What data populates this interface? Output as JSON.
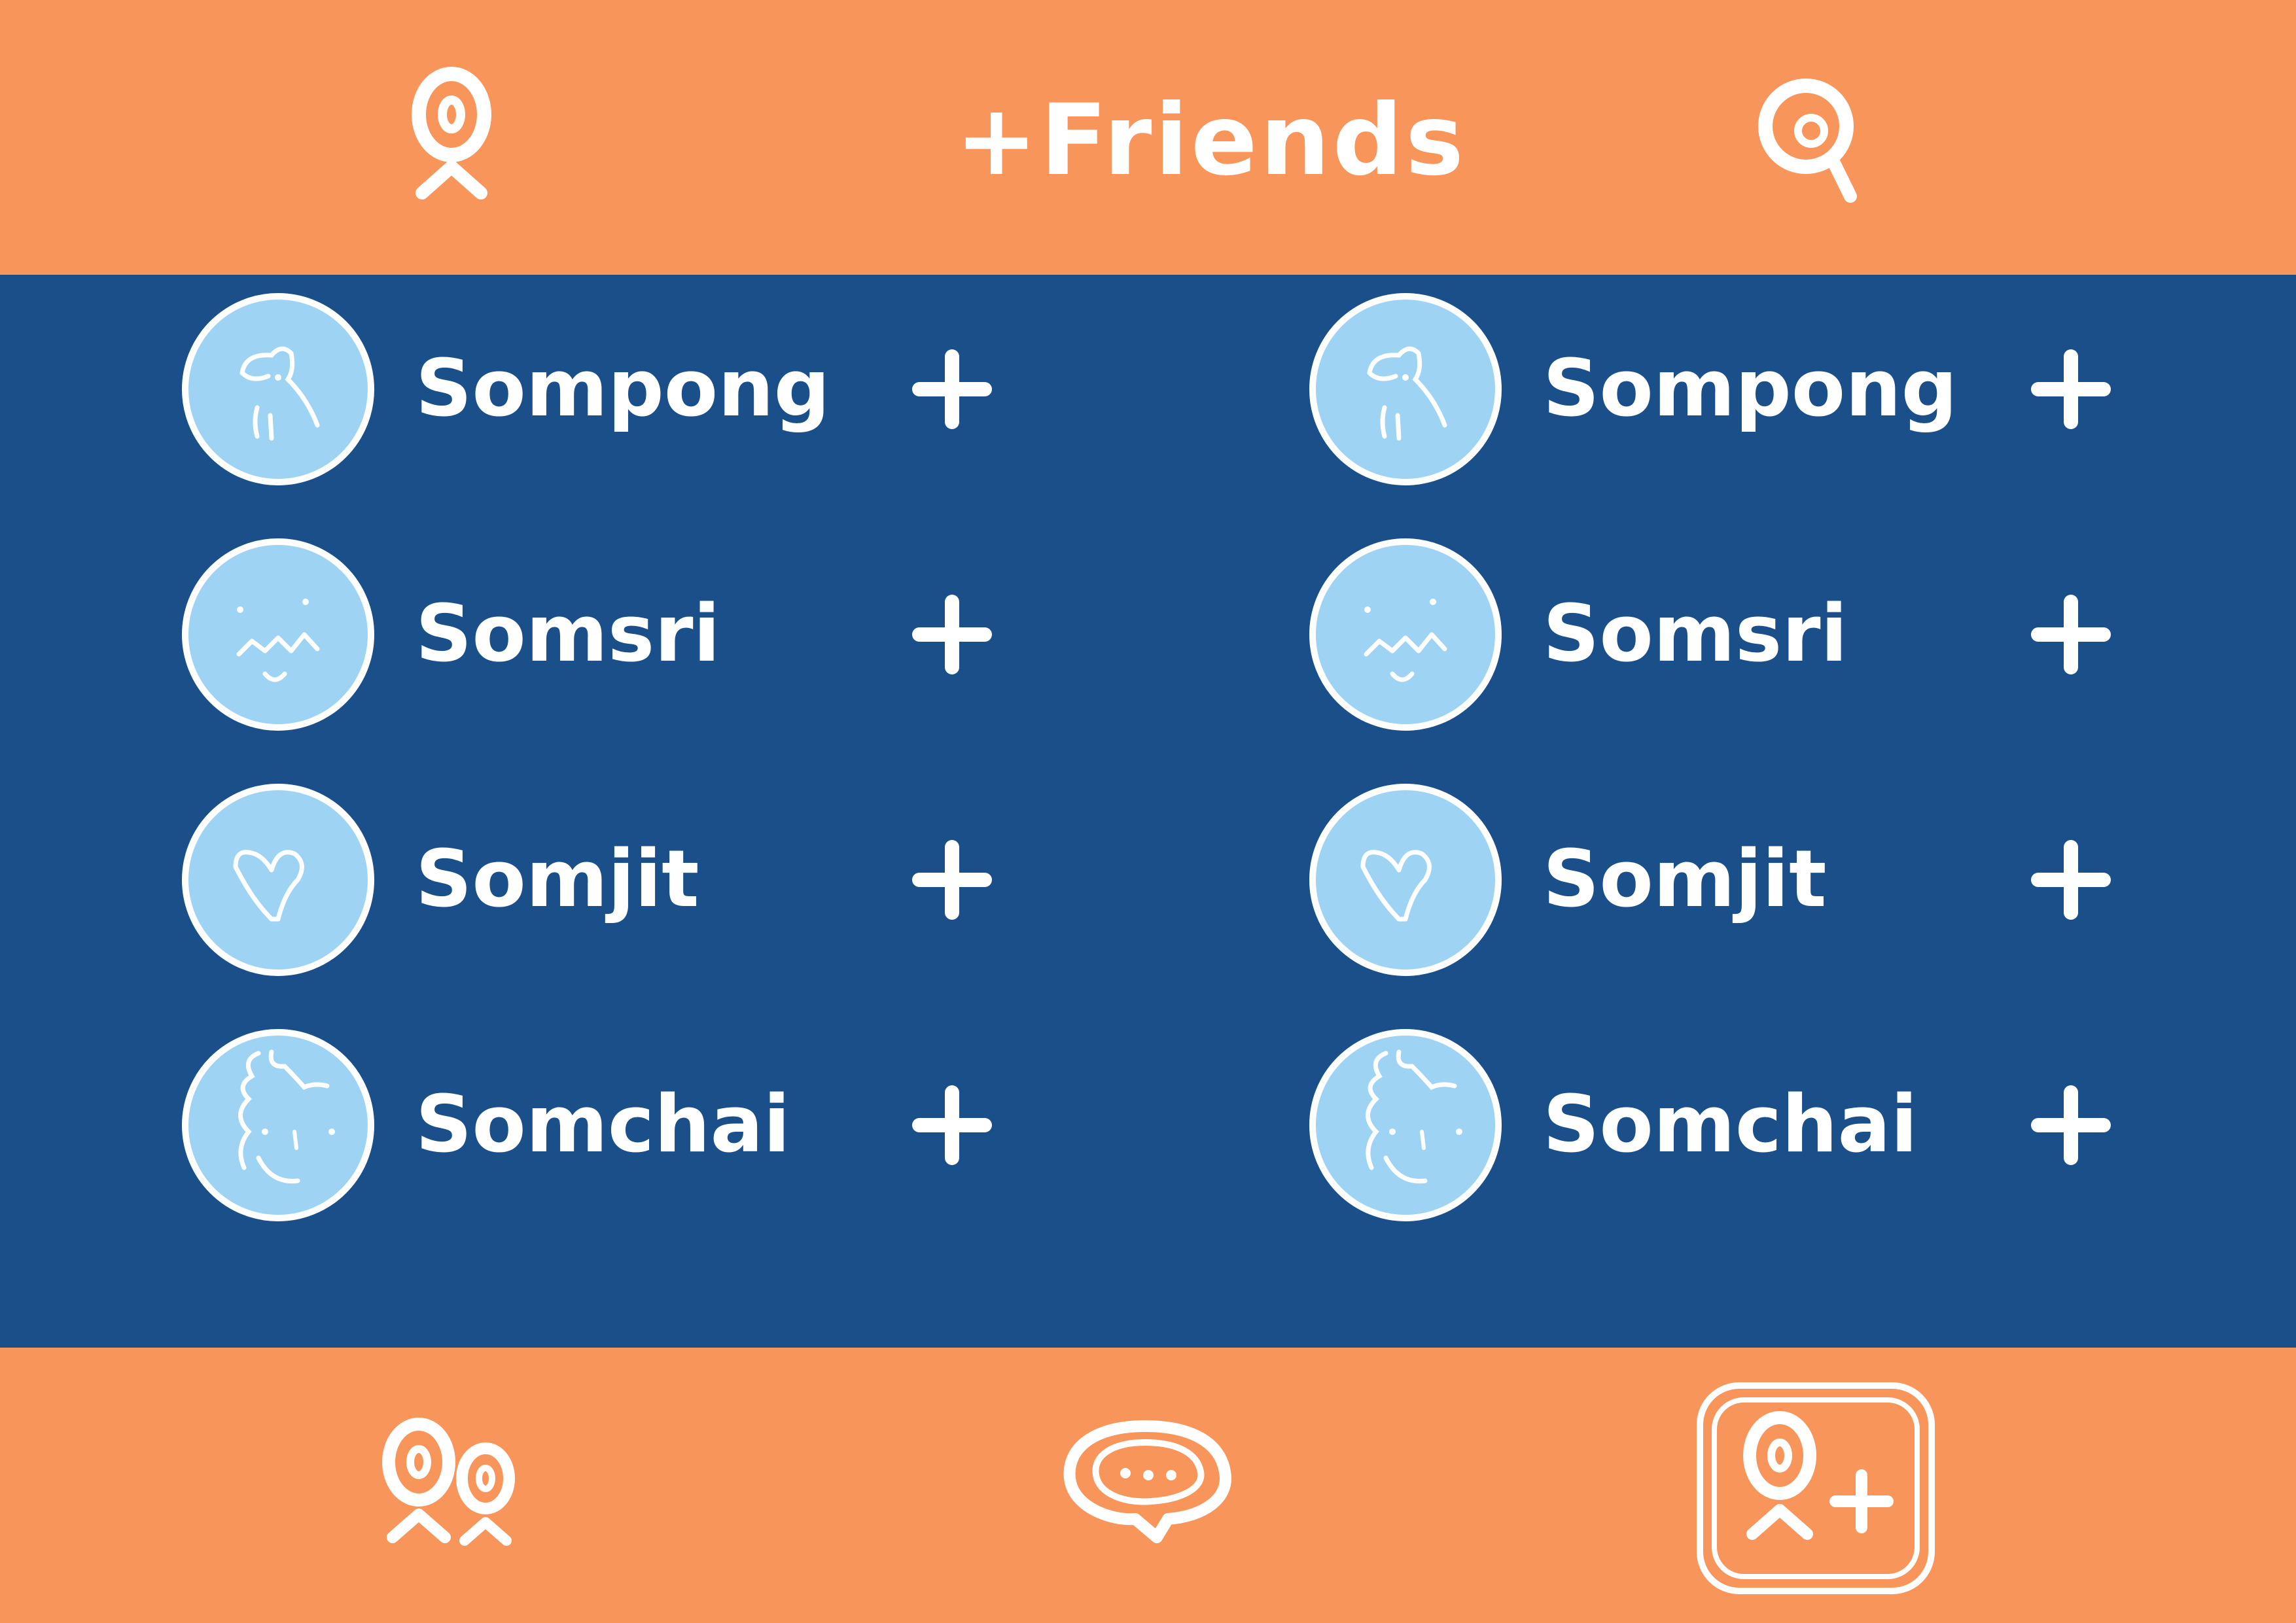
{
  "header": {
    "title": "+Friends",
    "profile_icon": "profile-icon",
    "search_icon": "search-icon"
  },
  "friends": [
    {
      "name": "Sompong",
      "avatar": "elephant-avatar",
      "add": "+"
    },
    {
      "name": "Somsri",
      "avatar": "smile-face-avatar",
      "add": "+"
    },
    {
      "name": "Somjit",
      "avatar": "heart-avatar",
      "add": "+"
    },
    {
      "name": "Somchai",
      "avatar": "curly-hair-face-avatar",
      "add": "+"
    },
    {
      "name": "Sompong",
      "avatar": "elephant-avatar",
      "add": "+"
    },
    {
      "name": "Somsri",
      "avatar": "smile-face-avatar",
      "add": "+"
    },
    {
      "name": "Somjit",
      "avatar": "heart-avatar",
      "add": "+"
    },
    {
      "name": "Somchai",
      "avatar": "curly-hair-face-avatar",
      "add": "+"
    }
  ],
  "scroll": {
    "position_fraction": 0.3
  },
  "bottom_nav": [
    {
      "icon": "friends-icon",
      "active": false
    },
    {
      "icon": "chat-icon",
      "active": false
    },
    {
      "icon": "add-friend-icon",
      "active": true
    }
  ],
  "colors": {
    "header": "#F7955A",
    "main": "#1A4F8A",
    "avatar": "#9FD3F3",
    "text": "#FFFFFF",
    "scroll_track": "#6375A5"
  }
}
